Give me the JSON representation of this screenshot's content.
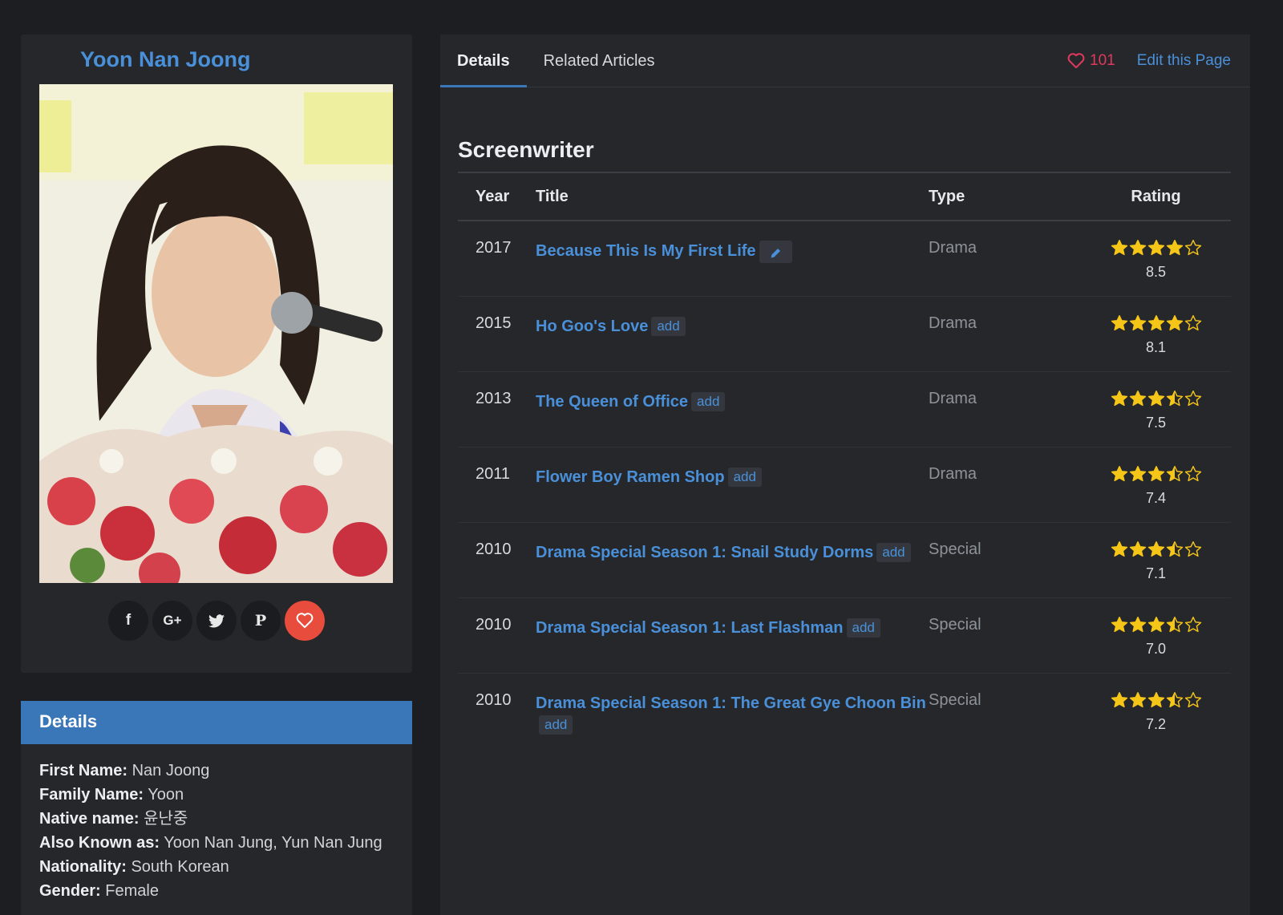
{
  "profile": {
    "name": "Yoon Nan Joong",
    "photo_icon": "portrait-photo",
    "share_icons": [
      "facebook-icon",
      "google-plus-icon",
      "twitter-icon",
      "pinterest-icon",
      "heart-icon"
    ]
  },
  "details": {
    "heading": "Details",
    "fields": [
      {
        "label": "First Name:",
        "value": "Nan Joong"
      },
      {
        "label": "Family Name:",
        "value": "Yoon"
      },
      {
        "label": "Native name:",
        "value": "윤난중"
      },
      {
        "label": "Also Known as:",
        "value": "Yoon Nan Jung, Yun Nan Jung"
      },
      {
        "label": "Nationality:",
        "value": "South Korean"
      },
      {
        "label": "Gender:",
        "value": "Female"
      }
    ]
  },
  "tabs": {
    "items": [
      "Details",
      "Related Articles"
    ],
    "likes": "101",
    "edit": "Edit this Page"
  },
  "section": {
    "title": "Screenwriter",
    "headers": {
      "year": "Year",
      "title": "Title",
      "type": "Type",
      "rating": "Rating"
    },
    "rows": [
      {
        "year": "2017",
        "title": "Because This Is My First Life",
        "tag": "edit",
        "type": "Drama",
        "rating": "8.5",
        "stars": 4
      },
      {
        "year": "2015",
        "title": "Ho Goo's Love",
        "tag": "add",
        "type": "Drama",
        "rating": "8.1",
        "stars": 4
      },
      {
        "year": "2013",
        "title": "The Queen of Office",
        "tag": "add",
        "type": "Drama",
        "rating": "7.5",
        "stars": 3.5
      },
      {
        "year": "2011",
        "title": "Flower Boy Ramen Shop",
        "tag": "add",
        "type": "Drama",
        "rating": "7.4",
        "stars": 3.5
      },
      {
        "year": "2010",
        "title": "Drama Special Season 1: Snail Study Dorms",
        "tag": "add",
        "type": "Special",
        "rating": "7.1",
        "stars": 3.5
      },
      {
        "year": "2010",
        "title": "Drama Special Season 1: Last Flashman",
        "tag": "add",
        "type": "Special",
        "rating": "7.0",
        "stars": 3.5
      },
      {
        "year": "2010",
        "title": "Drama Special Season 1: The Great Gye Choon Bin",
        "tag": "add",
        "type": "Special",
        "rating": "7.2",
        "stars": 3.5
      }
    ]
  },
  "colors": {
    "accent": "#4a90d9",
    "star": "#f5c518",
    "heart": "#e0395e",
    "header_bar": "#3a77b8"
  }
}
